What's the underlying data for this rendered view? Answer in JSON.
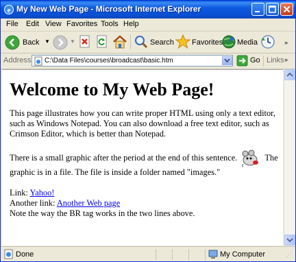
{
  "window": {
    "title": "My New Web Page - Microsoft Internet Explorer"
  },
  "menu": {
    "items": [
      "File",
      "Edit",
      "View",
      "Favorites",
      "Tools",
      "Help"
    ]
  },
  "toolbar": {
    "back_label": "Back",
    "search_label": "Search",
    "favorites_label": "Favorites",
    "media_label": "Media"
  },
  "addressbar": {
    "label": "Address",
    "url": "C:\\Data Files\\courses\\broadcast\\basic.htm",
    "go_label": "Go",
    "links_label": "Links"
  },
  "page": {
    "heading": "Welcome to My Web Page!",
    "para1": "This page illustrates how you can write proper HTML using only a text editor, such as Windows Notepad. You can also download a free text editor, such as Crimson Editor, which is better than Notepad.",
    "para2_before": "There is a small graphic after the period at the end of this sentence.",
    "para2_after": "The graphic is in a file. The file is inside a folder named \"images.\"",
    "link_label": "Link:",
    "link_text": "Yahoo!",
    "another_label": "Another link:",
    "another_text": "Another Web page",
    "note": "Note the way the BR tag works in the two lines above."
  },
  "status": {
    "text": "Done",
    "zone": "My Computer"
  }
}
